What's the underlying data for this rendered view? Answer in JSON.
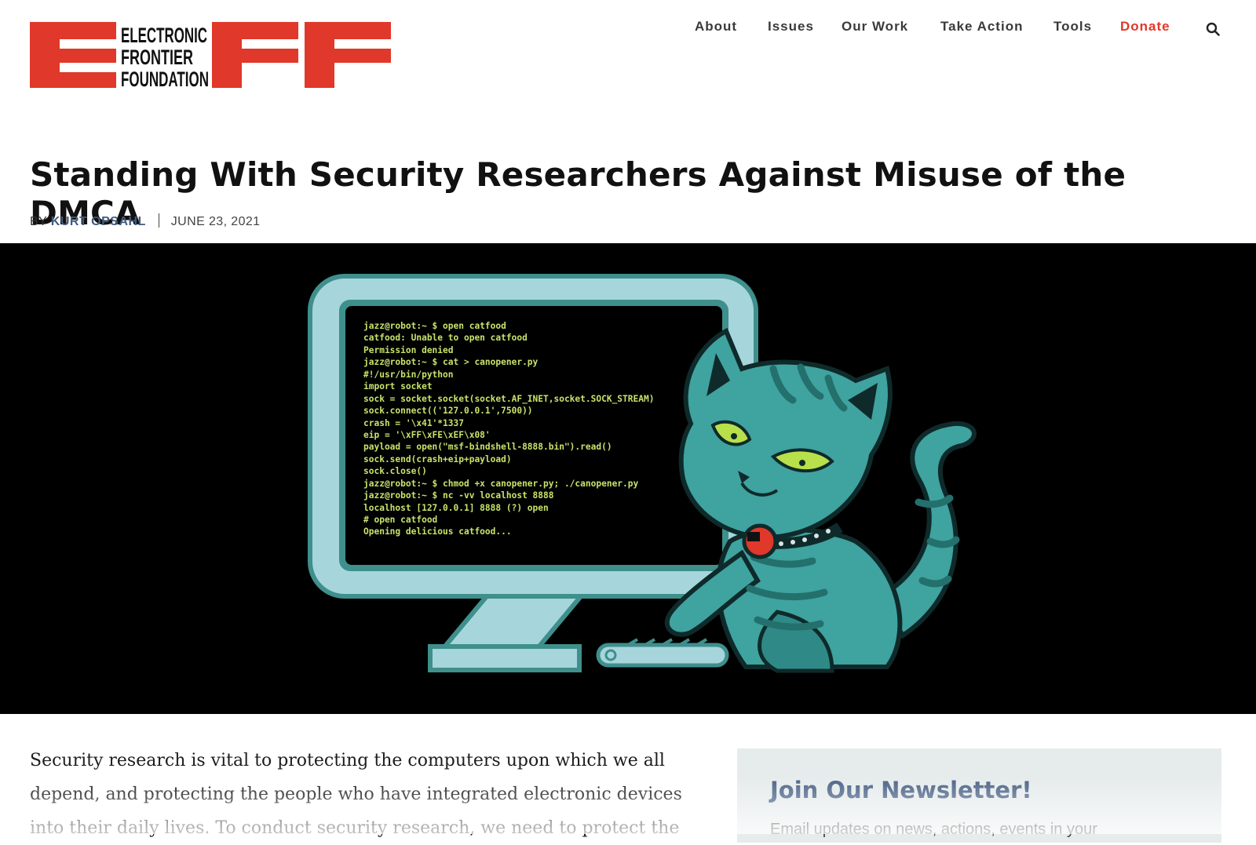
{
  "logo": {
    "line1": "ELECTRONIC",
    "line2": "FRONTIER",
    "line3": "FOUNDATION",
    "color": "#e0382a"
  },
  "nav": {
    "items": [
      "About",
      "Issues",
      "Our Work",
      "Take Action",
      "Tools"
    ],
    "donate": "Donate",
    "search_icon": "search-icon"
  },
  "article": {
    "title": "Standing With Security Researchers Against Misuse of the DMCA",
    "by": "BY",
    "author": "KURT OPSAHL",
    "date": "JUNE 23, 2021"
  },
  "hero": {
    "terminal_lines": [
      "jazz@robot:~ $ open catfood",
      "catfood: Unable to open catfood",
      "Permission denied",
      "jazz@robot:~ $ cat > canopener.py",
      "#!/usr/bin/python",
      "import socket",
      "sock = socket.socket(socket.AF_INET,socket.SOCK_STREAM)",
      "sock.connect(('127.0.0.1',7500))",
      "crash = '\\x41'*1337",
      "eip = '\\xFF\\xFE\\xEF\\x08'",
      "payload = open(\"msf-bindshell-8888.bin\").read()",
      "sock.send(crash+eip+payload)",
      "sock.close()",
      "jazz@robot:~ $ chmod +x canopener.py; ./canopener.py",
      "jazz@robot:~ $ nc -vv localhost 8888",
      "localhost [127.0.0.1] 8888 (?) open",
      "# open catfood",
      "Opening delicious catfood..."
    ],
    "terminal_color": "#c7e36a",
    "monitor_color": "#a6d6dc",
    "cat_color": "#3fa3a0"
  },
  "body": {
    "paragraph": "Security research is vital to protecting the computers upon which we all depend, and protecting the people who have integrated electronic devices into their daily lives. To conduct security research, we need to protect the"
  },
  "newsletter": {
    "heading": "Join Our Newsletter!",
    "text": "Email updates on news, actions, events in your"
  }
}
